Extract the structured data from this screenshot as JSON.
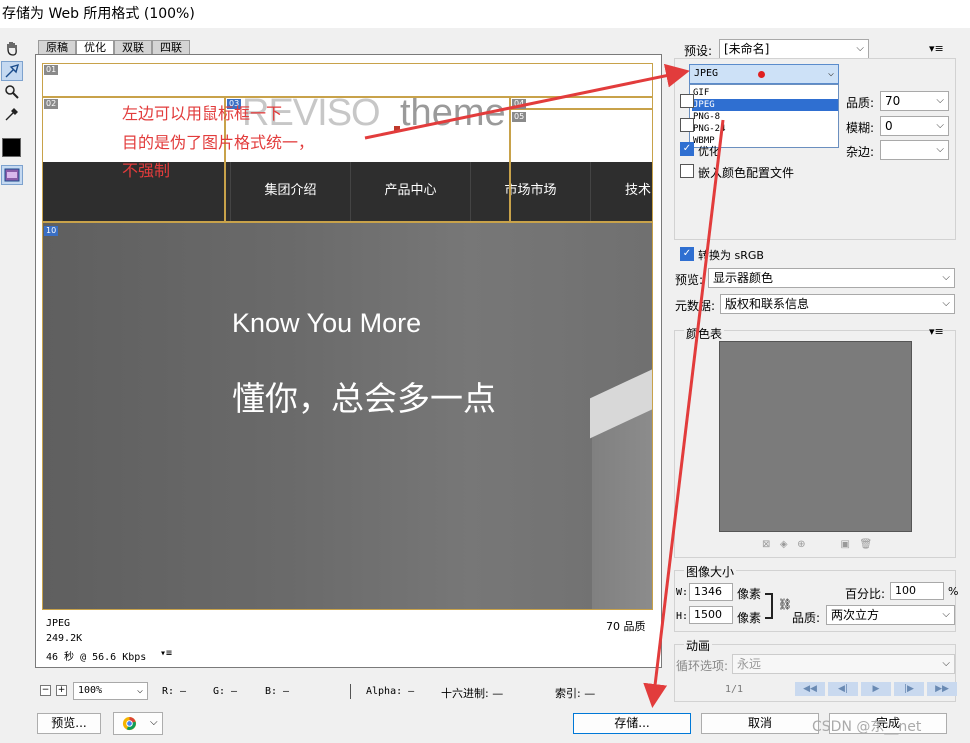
{
  "window": {
    "title": "存储为 Web 所用格式 (100%)"
  },
  "tabs": [
    "原稿",
    "优化",
    "双联",
    "四联"
  ],
  "active_tab": "优化",
  "preview": {
    "slices": [
      "01",
      "02",
      "03",
      "04",
      "05",
      "10"
    ],
    "logo_text": "REVISO",
    "logo_sub": "theme",
    "nav_items": [
      "集团介绍",
      "产品中心",
      "市场市场",
      "技术"
    ],
    "hero_title": "Know You More",
    "hero_subtitle": "懂你，总会多一点",
    "status_format": "JPEG",
    "status_size": "249.2K",
    "status_time": "46 秒 @ 56.6 Kbps",
    "status_quality": "70 品质"
  },
  "annotation": {
    "line1": "左边可以用鼠标框一下",
    "line2": "目的是伪了图片格式统一，",
    "line3": "不强制"
  },
  "settings": {
    "preset_label": "预设:",
    "preset_value": "[未命名]",
    "format_value": "JPEG",
    "format_options": [
      "GIF",
      "JPEG",
      "PNG-8",
      "PNG-24",
      "WBMP"
    ],
    "format_selected": "JPEG",
    "quality_label": "品质:",
    "quality_value": "70",
    "blur_label": "模糊:",
    "blur_value": "0",
    "matte_label": "杂边:",
    "optimized_label": "优化",
    "embed_profile_label": "嵌入颜色配置文件",
    "convert_srgb_label": "转换为 sRGB",
    "preview_label": "预览:",
    "preview_value": "显示器颜色",
    "metadata_label": "元数据:",
    "metadata_value": "版权和联系信息"
  },
  "color_table": {
    "title": "颜色表"
  },
  "image_size": {
    "title": "图像大小",
    "w_label": "W:",
    "w_value": "1346",
    "h_label": "H:",
    "h_value": "1500",
    "unit": "像素",
    "percent_label": "百分比:",
    "percent_value": "100",
    "percent_unit": "%",
    "quality_label": "品质:",
    "quality_value": "两次立方"
  },
  "animation": {
    "title": "动画",
    "loop_label": "循环选项:",
    "loop_value": "永远",
    "frame_counter": "1/1"
  },
  "bottom_bar": {
    "zoom_value": "100%",
    "r_label": "R: —",
    "g_label": "G: —",
    "b_label": "B: —",
    "alpha_label": "Alpha: —",
    "hex_label": "十六进制: —",
    "index_label": "索引: —"
  },
  "buttons": {
    "preview": "预览...",
    "save": "存储...",
    "cancel": "取消",
    "done": "完成"
  },
  "watermark": "CSDN @东__net",
  "colors": {
    "accent": "#2f6fd1",
    "annotation": "#e23c3c",
    "nav_bg": "#2e2e2e",
    "slice_border": "#c8a24a"
  }
}
